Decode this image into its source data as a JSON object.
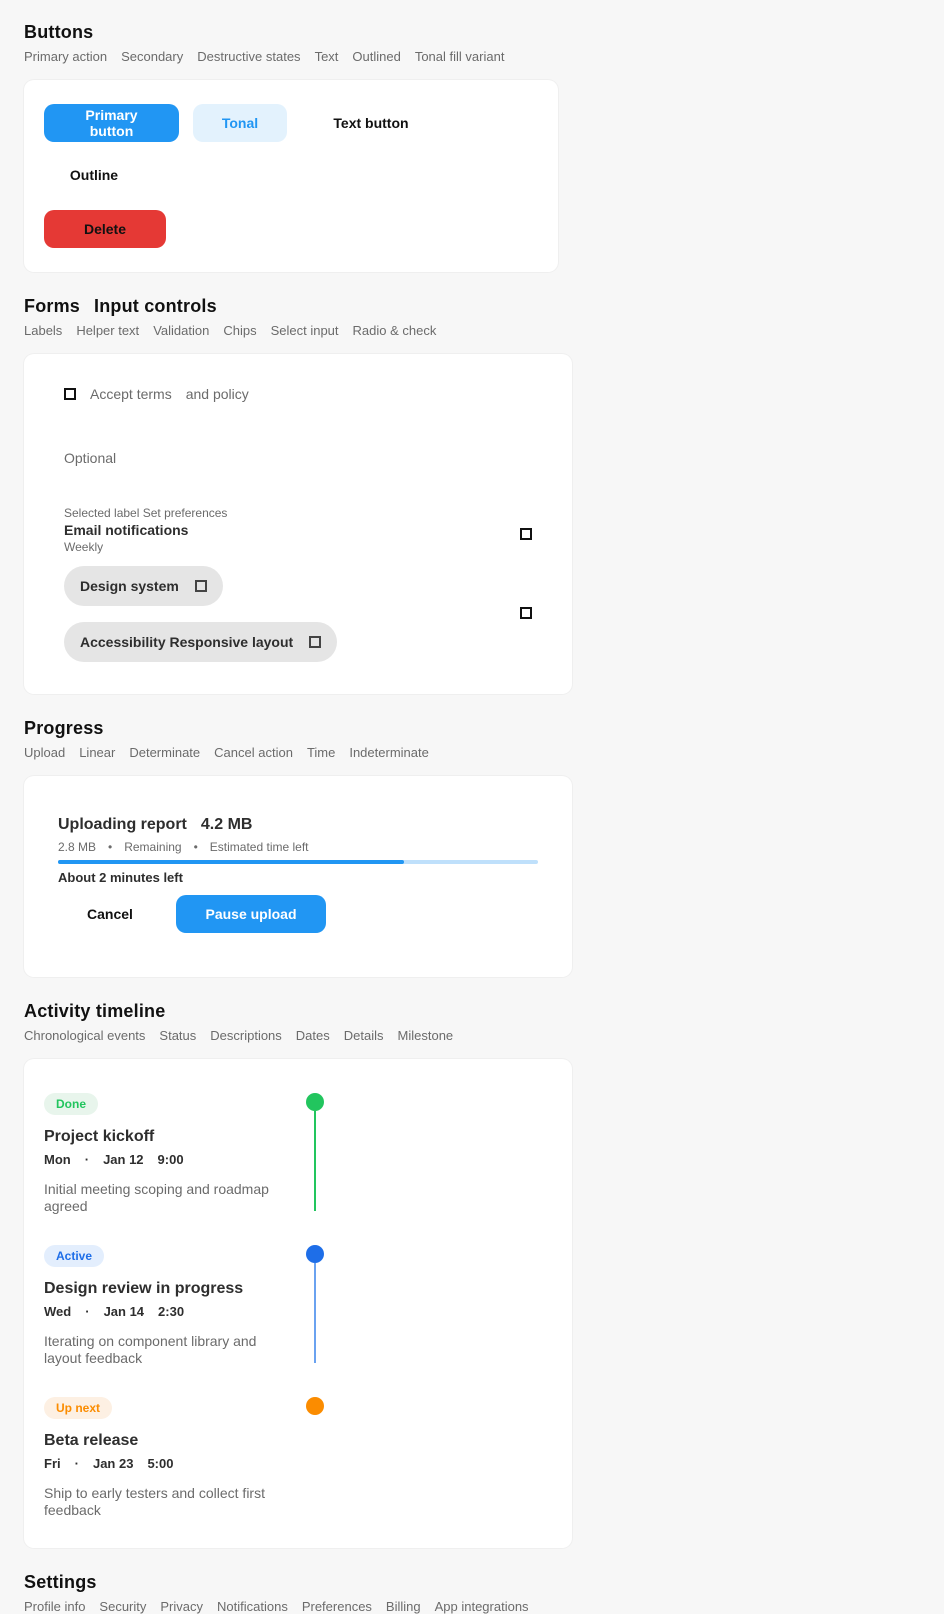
{
  "buttons_section": {
    "title": "Buttons",
    "tags": [
      "Primary action",
      "Secondary",
      "Destructive states",
      "Text",
      "Outlined",
      "Tonal fill variant"
    ],
    "primary_label": "Primary button",
    "soft_label": "Tonal",
    "text_label": "Text button",
    "text2_label": "Outline",
    "danger_label": "Delete"
  },
  "forms_section": {
    "title": "Forms",
    "subtitle": "Input controls",
    "tags": [
      "Labels",
      "Helper text",
      "Validation",
      "Chips",
      "Select input",
      "Radio & check"
    ],
    "check_label": "Accept terms",
    "check_meta": "and policy",
    "muted_label": "Optional",
    "field": {
      "helper": "Selected label Set preferences",
      "title": "Email notifications",
      "caption": "Weekly"
    },
    "chip1": "Design system",
    "chip2": "Accessibility Responsive layout"
  },
  "progress_section": {
    "title": "Progress",
    "tags": [
      "Upload",
      "Linear",
      "Determinate",
      "Cancel action",
      "Time",
      "Indeterminate"
    ],
    "file_title": "Uploading report",
    "file_size": "4.2 MB",
    "meta": [
      "2.8 MB",
      "•",
      "Remaining",
      "•",
      "Estimated time left"
    ],
    "progress_fraction": 0.72,
    "time_label": "About 2 minutes left",
    "cancel_label": "Cancel",
    "pause_label": "Pause upload"
  },
  "timeline_section": {
    "title": "Activity timeline",
    "tags": [
      "Chronological events",
      "Status",
      "Descriptions",
      "Dates",
      "Details",
      "Milestone"
    ],
    "items": [
      {
        "badge": "Done",
        "badge_class": "b-green",
        "color": "#22c55e",
        "title": "Project kickoff",
        "date_parts": [
          "Mon",
          "·",
          "Jan 12",
          "9:00"
        ],
        "body": "Initial meeting scoping and roadmap agreed"
      },
      {
        "badge": "Active",
        "badge_class": "b-blue",
        "color": "#1e6ee8",
        "title": "Design review in progress",
        "date_parts": [
          "Wed",
          "·",
          "Jan 14",
          "2:30"
        ],
        "body": "Iterating on component library and layout feedback"
      },
      {
        "badge": "Up next",
        "badge_class": "b-orange",
        "color": "#fb8c00",
        "title": "Beta release",
        "date_parts": [
          "Fri",
          "·",
          "Jan 23",
          "5:00"
        ],
        "body": "Ship to early testers and collect first feedback"
      }
    ]
  },
  "next_section": {
    "title": "Settings",
    "tags": [
      "Profile info",
      "Security",
      "Privacy",
      "Notifications",
      "Preferences",
      "Billing",
      "App integrations"
    ]
  }
}
